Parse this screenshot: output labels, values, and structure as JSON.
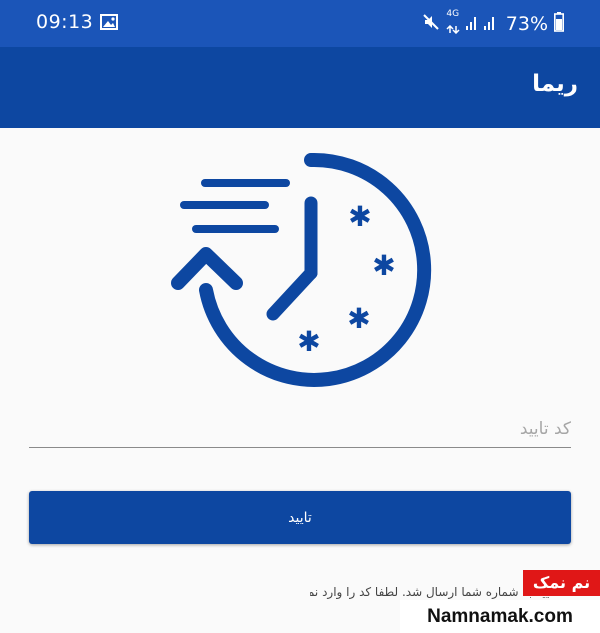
{
  "status_bar": {
    "time": "09:13",
    "network_label": "4G",
    "battery": "73%",
    "icons": [
      "gallery-icon",
      "mute-icon",
      "signal-icon",
      "battery-icon"
    ]
  },
  "app_bar": {
    "title": "ریما"
  },
  "hero": {
    "icon": "fast-history-clock-icon",
    "color": "#0d47a1"
  },
  "form": {
    "code_placeholder": "کد تایید",
    "code_value": "",
    "confirm_label": "تایید"
  },
  "help_text": "کد تایید به شماره شما ارسال شد. لطفا کد را وارد نمایید.",
  "watermark": {
    "badge": "نم نمک",
    "domain": "Namnamak.com"
  },
  "colors": {
    "status_bar": "#1b55b8",
    "primary": "#0d47a1",
    "background": "#fafafa"
  }
}
